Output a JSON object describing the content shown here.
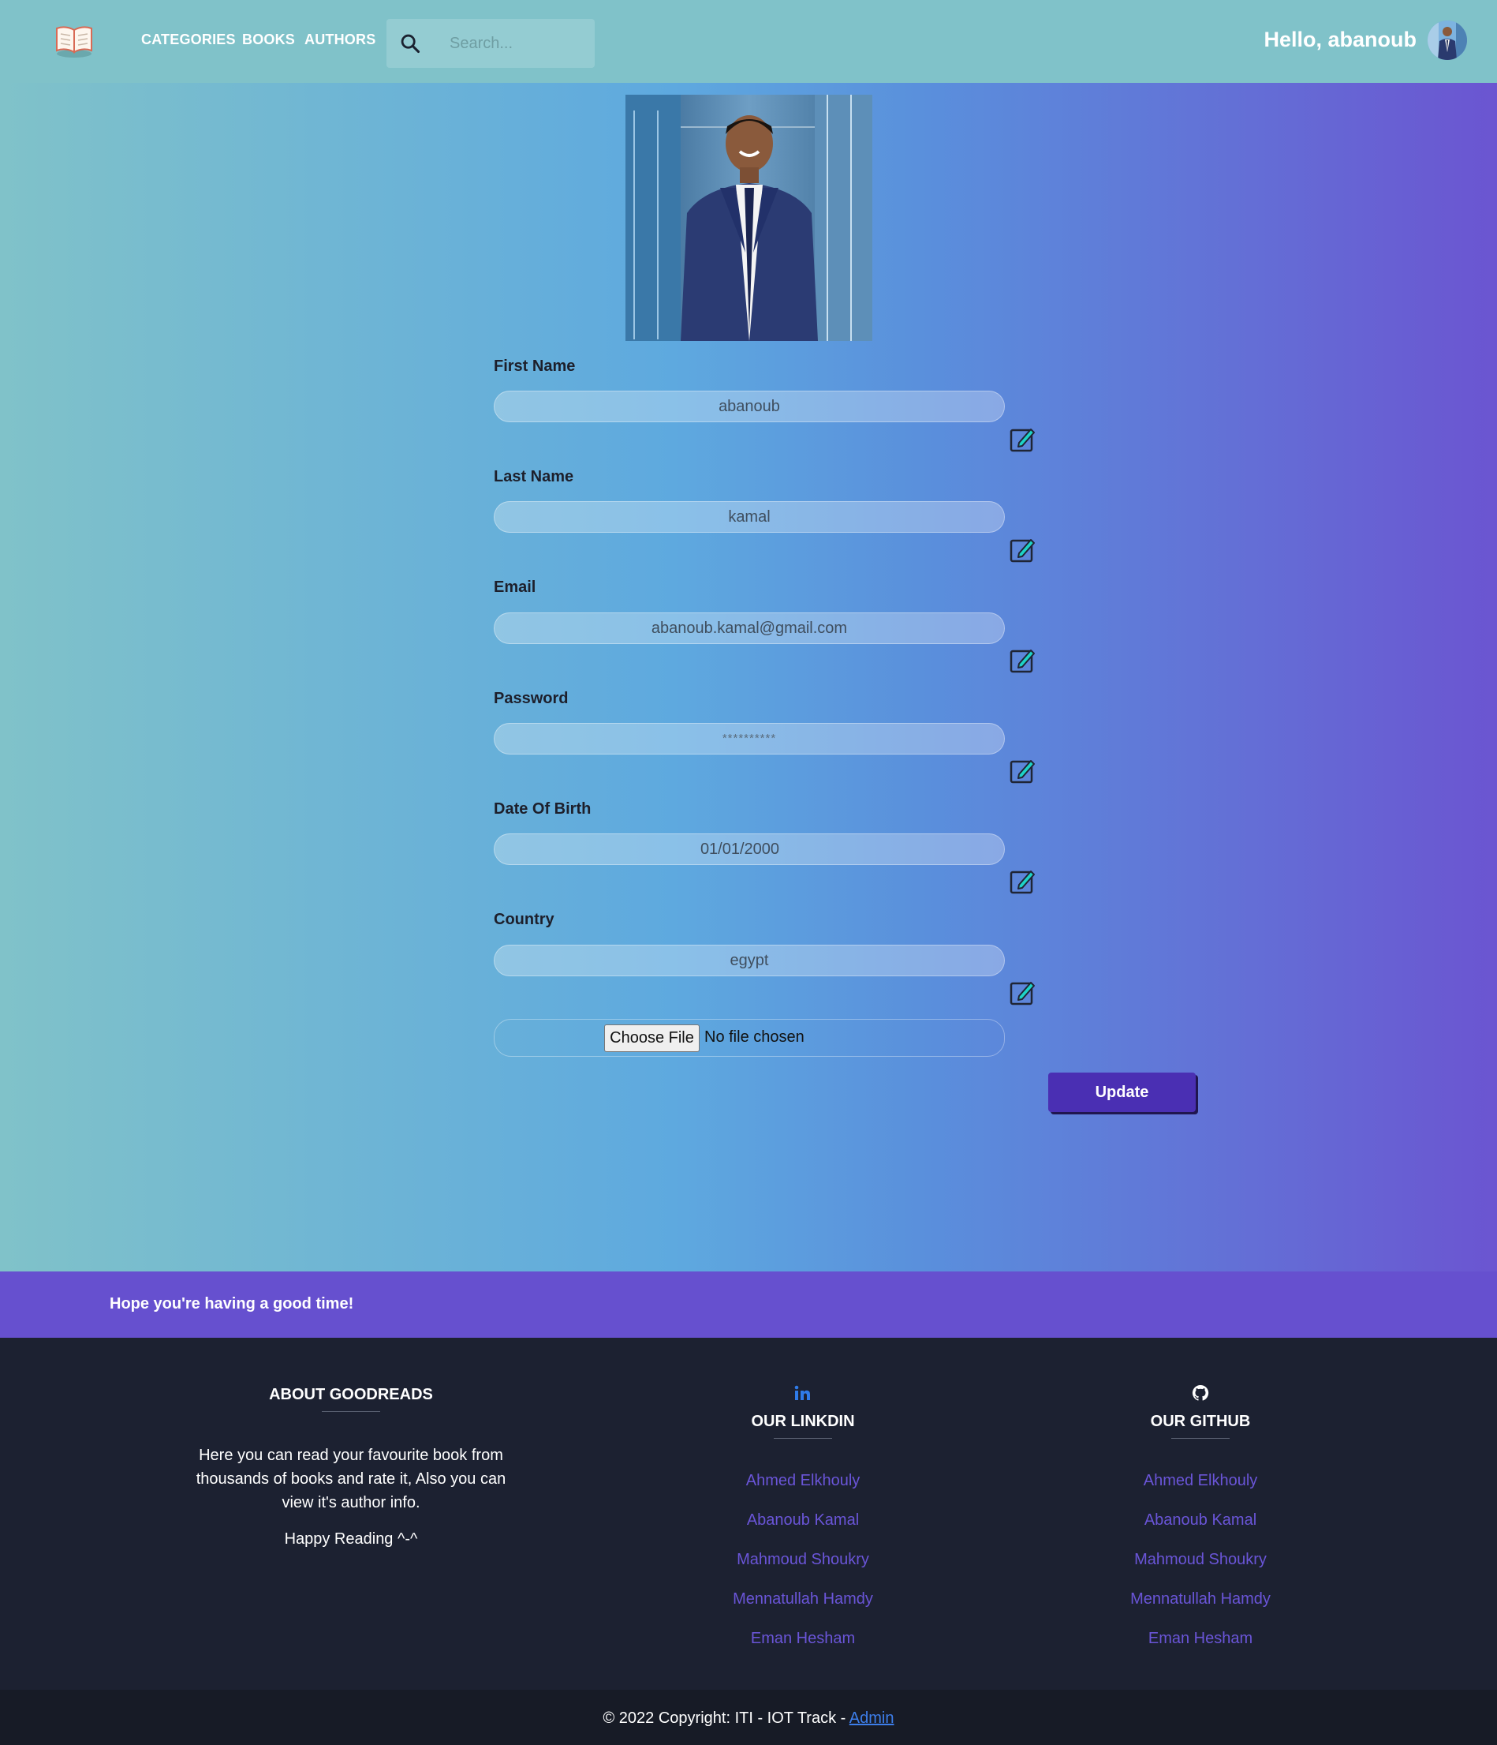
{
  "nav": {
    "logo_icon": "open-book-icon",
    "links": [
      "CATEGORIES",
      "BOOKS",
      "AUTHORS"
    ],
    "search_placeholder": "Search...",
    "greeting": "Hello, abanoub"
  },
  "profile": {
    "fields": [
      {
        "label": "First Name",
        "value": "abanoub"
      },
      {
        "label": "Last Name",
        "value": "kamal"
      },
      {
        "label": "Email",
        "value": "abanoub.kamal@gmail.com"
      },
      {
        "label": "Password",
        "value": "**********"
      },
      {
        "label": "Date Of Birth",
        "value": "01/01/2000"
      },
      {
        "label": "Country",
        "value": "egypt"
      }
    ],
    "file": {
      "button_label": "Choose File",
      "status": "No file chosen"
    },
    "update_label": "Update"
  },
  "banner": {
    "text": "Hope you're having a good time!"
  },
  "footer": {
    "about": {
      "title": "ABOUT GOODREADS",
      "text": "Here you can read your favourite book from thousands of books and rate it, Also you can view it's author info.",
      "closing": "Happy Reading ^-^"
    },
    "linkedin": {
      "icon": "linkedin-icon",
      "title": "OUR LINKDIN",
      "names": [
        "Ahmed Elkhouly",
        "Abanoub Kamal",
        "Mahmoud Shoukry",
        "Mennatullah Hamdy",
        "Eman Hesham"
      ]
    },
    "github": {
      "icon": "github-icon",
      "title": "OUR GITHUB",
      "names": [
        "Ahmed Elkhouly",
        "Abanoub Kamal",
        "Mahmoud Shoukry",
        "Mennatullah Hamdy",
        "Eman Hesham"
      ]
    },
    "copyright_text": "© 2022 Copyright: ITI - IOT Track - ",
    "admin_link": "Admin"
  },
  "colors": {
    "navbar": "#80c2c9",
    "banner": "#6650cf",
    "footer": "#1c2131",
    "update_button": "#4a2fb3",
    "footer_link": "#6a55d8"
  }
}
